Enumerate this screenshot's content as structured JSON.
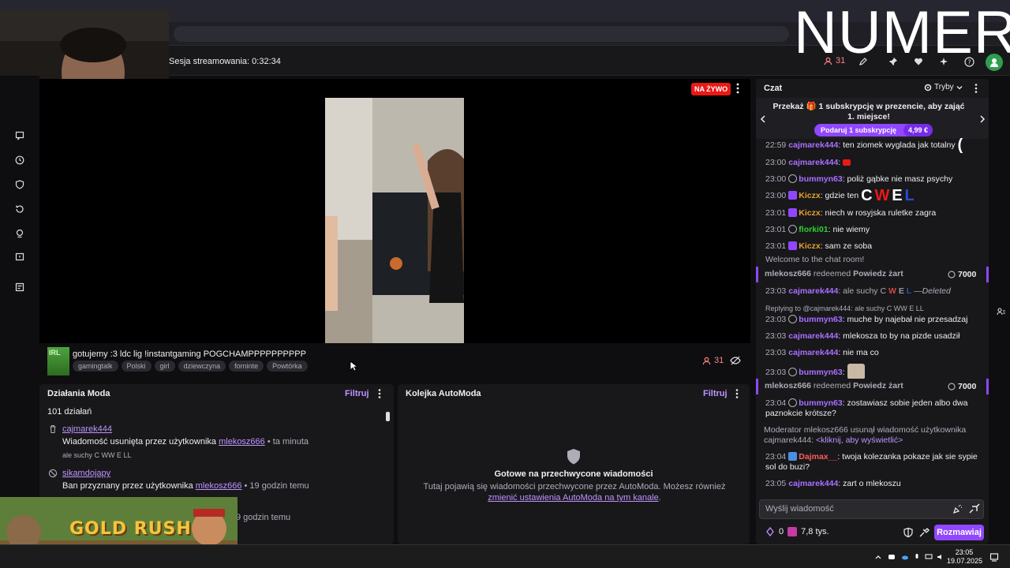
{
  "overlay": {
    "logo_text": "NUMER"
  },
  "topbar": {
    "session_label": "Sesja streamowania: 0:32:34",
    "viewer_count": "31"
  },
  "preview": {
    "live_badge": "NA ŻYWO"
  },
  "stream": {
    "title": "gotujemy :3 ldc lig !instantgaming POGCHAMPPPPPPPPPP",
    "game_thumb_label": "IRL",
    "tags": [
      "gamingtalk",
      "Polski",
      "girl",
      "dziewczyna",
      "forninte",
      "Powtórka"
    ],
    "viewers": "31"
  },
  "mod_actions": {
    "title": "Działania Moda",
    "filter_label": "Filtruj",
    "count": "101 działań",
    "items": [
      {
        "user": "cajmarek444",
        "text": "Wiadomość usunięta przez użytkownika",
        "by": "mlekosz666",
        "when": "• ta minuta",
        "sub": "ale suchy C WW E LL"
      },
      {
        "user": "sikamdojapy",
        "text": "Ban przyznany przez użytkownika",
        "by": "mlekosz666",
        "when": "• 19 godzin temu",
        "sub": ""
      },
      {
        "when": "9 godzin temu"
      }
    ]
  },
  "automod": {
    "title": "Kolejka AutoModa",
    "filter_label": "Filtruj",
    "heading": "Gotowe na przechwycone wiadomości",
    "desc": "Tutaj pojawią się wiadomości przechwycone przez AutoModa. Możesz również",
    "link": "zmienić ustawienia AutoModa na tym kanale",
    "desc_end": "."
  },
  "chat": {
    "title": "Czat",
    "modes_label": "Tryby",
    "gift_text": "Przekaż 🎁 1 subskrypcję w prezencie, aby zająć 1. miejsce!",
    "gift_button": "Podaruj 1 subskrypcję",
    "gift_price": "4,99 €",
    "lines": [
      {
        "ts": "22:59",
        "user": "cajmarek444",
        "msg": ": ten ziomek wyglada jak totalny"
      },
      {
        "ts": "23:00",
        "user": "cajmarek444",
        "msg": ":"
      },
      {
        "ts": "23:00",
        "user": "bummyn63",
        "msg": ": poliż gąbke nie masz psychy"
      },
      {
        "ts": "23:00",
        "user": "Kiczx",
        "msg": ": gdzie ten"
      },
      {
        "ts": "23:01",
        "user": "Kiczx",
        "msg": ": niech w rosyjska ruletke zagra"
      },
      {
        "ts": "23:01",
        "user": "florki01",
        "msg": ": nie wiemy"
      },
      {
        "ts": "23:01",
        "user": "Kiczx",
        "msg": ": sam ze soba"
      },
      {
        "welcome": "Welcome to the chat room!"
      },
      {
        "ts": "23:03",
        "user": "cajmarek444",
        "msg": ": ale suchy C",
        "deleted": "—Deleted"
      },
      {
        "ts": "23:03",
        "user": "bummyn63",
        "msg": ": muche by najebał nie przesadzaj"
      },
      {
        "ts": "23:03",
        "user": "cajmarek444",
        "msg": ": mlekosza to by na pizde usadził"
      },
      {
        "ts": "23:03",
        "user": "cajmarek444",
        "msg": ": nie ma co"
      },
      {
        "ts": "23:03",
        "user": "bummyn63",
        "msg": ":"
      },
      {
        "ts": "23:04",
        "user": "bummyn63",
        "msg": ": zostawiasz sobie jeden albo dwa paznokcie krótsze?"
      },
      {
        "ts": "23:04",
        "user": "Dajmax__",
        "msg": ": twoja kolezanka pokaze jak sie sypie sol do buzi?"
      },
      {
        "ts": "23:05",
        "user": "cajmarek444",
        "msg": ": zart o mlekoszu"
      }
    ],
    "emote_letters": [
      "C",
      "W",
      "E",
      "L"
    ],
    "deleted_letters": [
      "W",
      "E",
      "L"
    ],
    "reply_text": "Replying to @cajmarek444: ale suchy C WW E LL",
    "redeem1": {
      "user": "mlekosz666",
      "verb": "redeemed",
      "reward": "Powiedz żart",
      "points": "7000"
    },
    "redeem2": {
      "user": "mlekosz666",
      "verb": "redeemed",
      "reward": "Powiedz żart",
      "points": "7000"
    },
    "mod_notice": "Moderator mlekosz666 usunął wiadomość użytkownika cajmarek444:",
    "mod_notice_link": "<kliknij, aby wyświetlić>",
    "input_placeholder": "Wyślij wiadomość",
    "points_count": "0",
    "bits_count": "7,8 tys.",
    "send_label": "Rozmawiaj"
  },
  "taskbar": {
    "time": "23:05",
    "date": "19.07.2025"
  },
  "overlays": {
    "game_banner": "GOLD RUSH"
  },
  "colors": {
    "accent": "#9147ff",
    "live": "#e91916",
    "username_purple": "#a970ff",
    "username_orange": "#e5a12b",
    "username_green": "#2fd12f"
  }
}
